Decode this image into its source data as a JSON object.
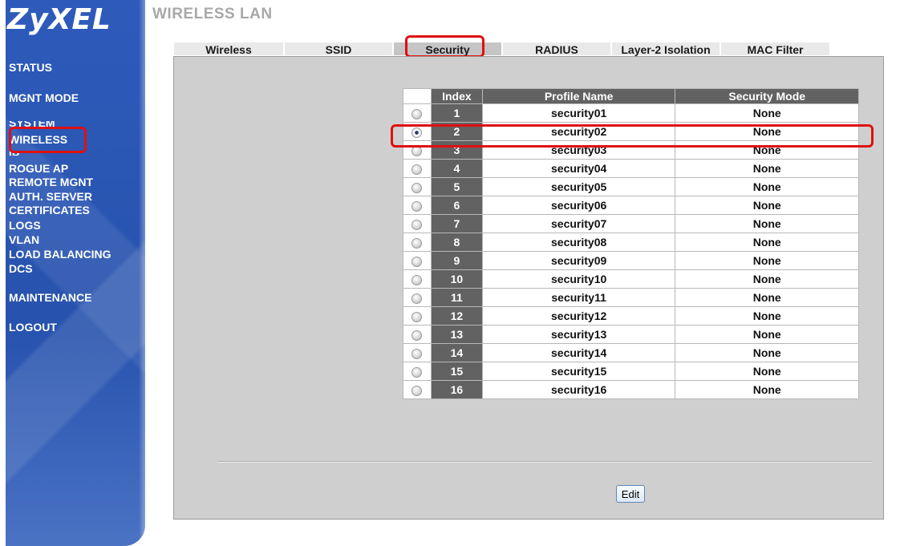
{
  "brand": {
    "logo": "ZyXEL"
  },
  "header": {
    "title": "WIRELESS LAN"
  },
  "sidebar": {
    "items": [
      {
        "label": "STATUS"
      },
      {
        "label": "MGNT MODE"
      },
      {
        "label": "SYSTEM"
      },
      {
        "label": "WIRELESS"
      },
      {
        "label": "IP"
      },
      {
        "label": "ROGUE AP"
      },
      {
        "label": "REMOTE MGNT"
      },
      {
        "label": "AUTH. SERVER"
      },
      {
        "label": "CERTIFICATES"
      },
      {
        "label": "LOGS"
      },
      {
        "label": "VLAN"
      },
      {
        "label": "LOAD BALANCING"
      },
      {
        "label": "DCS"
      },
      {
        "label": "MAINTENANCE"
      },
      {
        "label": "LOGOUT"
      }
    ]
  },
  "tabs": [
    {
      "label": "Wireless"
    },
    {
      "label": "SSID"
    },
    {
      "label": "Security",
      "active": true
    },
    {
      "label": "RADIUS"
    },
    {
      "label": "Layer-2 Isolation"
    },
    {
      "label": "MAC Filter"
    }
  ],
  "table": {
    "headers": {
      "index": "Index",
      "profile_name": "Profile Name",
      "security_mode": "Security Mode"
    },
    "selected_index": 2,
    "rows": [
      {
        "index": "1",
        "name": "security01",
        "mode": "None"
      },
      {
        "index": "2",
        "name": "security02",
        "mode": "None"
      },
      {
        "index": "3",
        "name": "security03",
        "mode": "None"
      },
      {
        "index": "4",
        "name": "security04",
        "mode": "None"
      },
      {
        "index": "5",
        "name": "security05",
        "mode": "None"
      },
      {
        "index": "6",
        "name": "security06",
        "mode": "None"
      },
      {
        "index": "7",
        "name": "security07",
        "mode": "None"
      },
      {
        "index": "8",
        "name": "security08",
        "mode": "None"
      },
      {
        "index": "9",
        "name": "security09",
        "mode": "None"
      },
      {
        "index": "10",
        "name": "security10",
        "mode": "None"
      },
      {
        "index": "11",
        "name": "security11",
        "mode": "None"
      },
      {
        "index": "12",
        "name": "security12",
        "mode": "None"
      },
      {
        "index": "13",
        "name": "security13",
        "mode": "None"
      },
      {
        "index": "14",
        "name": "security14",
        "mode": "None"
      },
      {
        "index": "15",
        "name": "security15",
        "mode": "None"
      },
      {
        "index": "16",
        "name": "security16",
        "mode": "None"
      }
    ]
  },
  "actions": {
    "edit_label": "Edit"
  },
  "colors": {
    "sidebar": "#2a55b0",
    "highlight": "#e01010",
    "table_header": "#626262",
    "panel": "#cfcfcf"
  }
}
